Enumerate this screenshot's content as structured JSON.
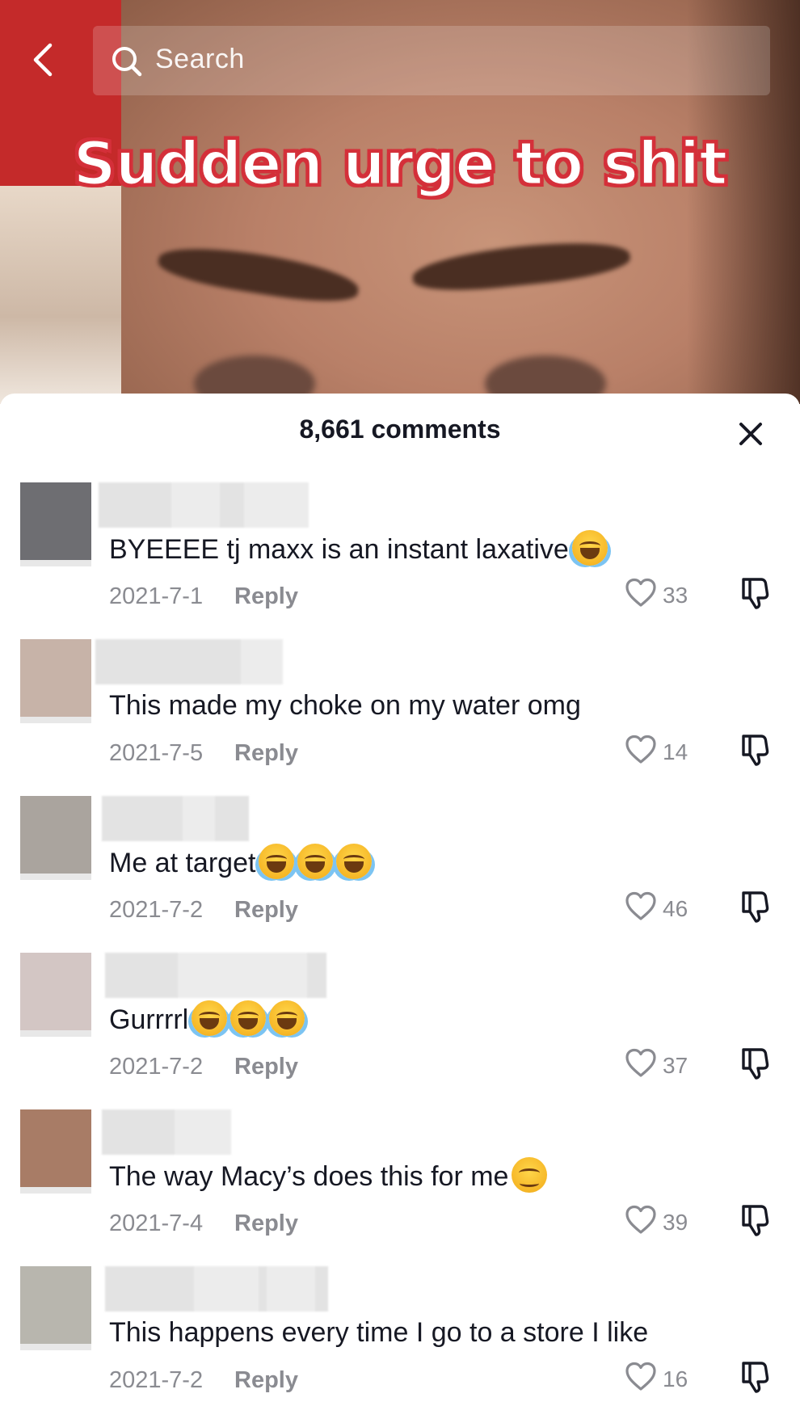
{
  "video": {
    "caption": "Sudden urge to shit"
  },
  "top_bar": {
    "back_icon": "chevron-left-icon",
    "search_placeholder": "Search",
    "search_icon": "search-icon"
  },
  "comments_panel": {
    "count_label": "8,661 comments",
    "close_icon": "close-icon",
    "reply_label": "Reply",
    "comments": [
      {
        "text": "BYEEEE tj maxx is an instant laxative",
        "emojis": [
          "tears"
        ],
        "date": "2021-7-1",
        "likes": "33",
        "avatar_color": "#6e6e72"
      },
      {
        "text": "This made my choke on my water omg",
        "emojis": [],
        "date": "2021-7-5",
        "likes": "14",
        "avatar_color": "#c7b3a8"
      },
      {
        "text": "Me at target",
        "emojis": [
          "tears",
          "tears",
          "tears"
        ],
        "date": "2021-7-2",
        "likes": "46",
        "avatar_color": "#aaa49e"
      },
      {
        "text": "Gurrrrl",
        "emojis": [
          "tears",
          "tears",
          "tears"
        ],
        "date": "2021-7-2",
        "likes": "37",
        "avatar_color": "#d3c6c4"
      },
      {
        "text": "The way Macy’s does this for me",
        "emojis": [
          "content"
        ],
        "date": "2021-7-4",
        "likes": "39",
        "avatar_color": "#a87c66"
      },
      {
        "text": "This happens every time I go to a store I like",
        "emojis": [],
        "date": "2021-7-2",
        "likes": "16",
        "avatar_color": "#b8b6ae"
      }
    ]
  }
}
